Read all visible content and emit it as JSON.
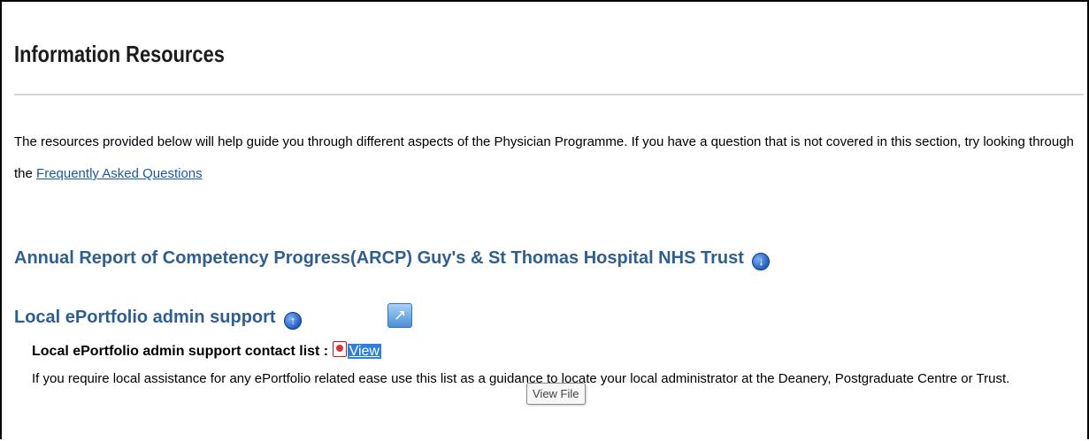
{
  "page": {
    "title": "Information Resources",
    "intro_before_link": "The resources provided below will help guide you through different aspects of the Physician Programme. If you have a question that is not covered in this section, try looking through the ",
    "faq_link": "Frequently Asked Questions"
  },
  "sections": {
    "arcp_heading": "Annual Report of Competency Progress(ARCP) Guy's & St Thomas Hospital NHS Trust",
    "local_heading": "Local ePortfolio admin support",
    "contact_label": "Local ePortfolio admin support contact list",
    "separator": " : ",
    "view_link": "View",
    "description_part1": "If you require local assistance for any ePortfolio related ",
    "description_part2": "ease use this list as a guidance to locate your local administrator at the Deanery, Postgraduate Centre or Trust."
  },
  "tooltip": {
    "text": "View File"
  },
  "icons": {
    "arcp_toggle": "down-arrow-circle-icon",
    "local_toggle": "up-arrow-circle-icon",
    "popout": "popout-icon",
    "pdf": "pdf-file-icon"
  },
  "colors": {
    "heading": "#2f5f8f",
    "link": "#1a5aa5",
    "selected_link_bg": "#2f7fe2"
  }
}
